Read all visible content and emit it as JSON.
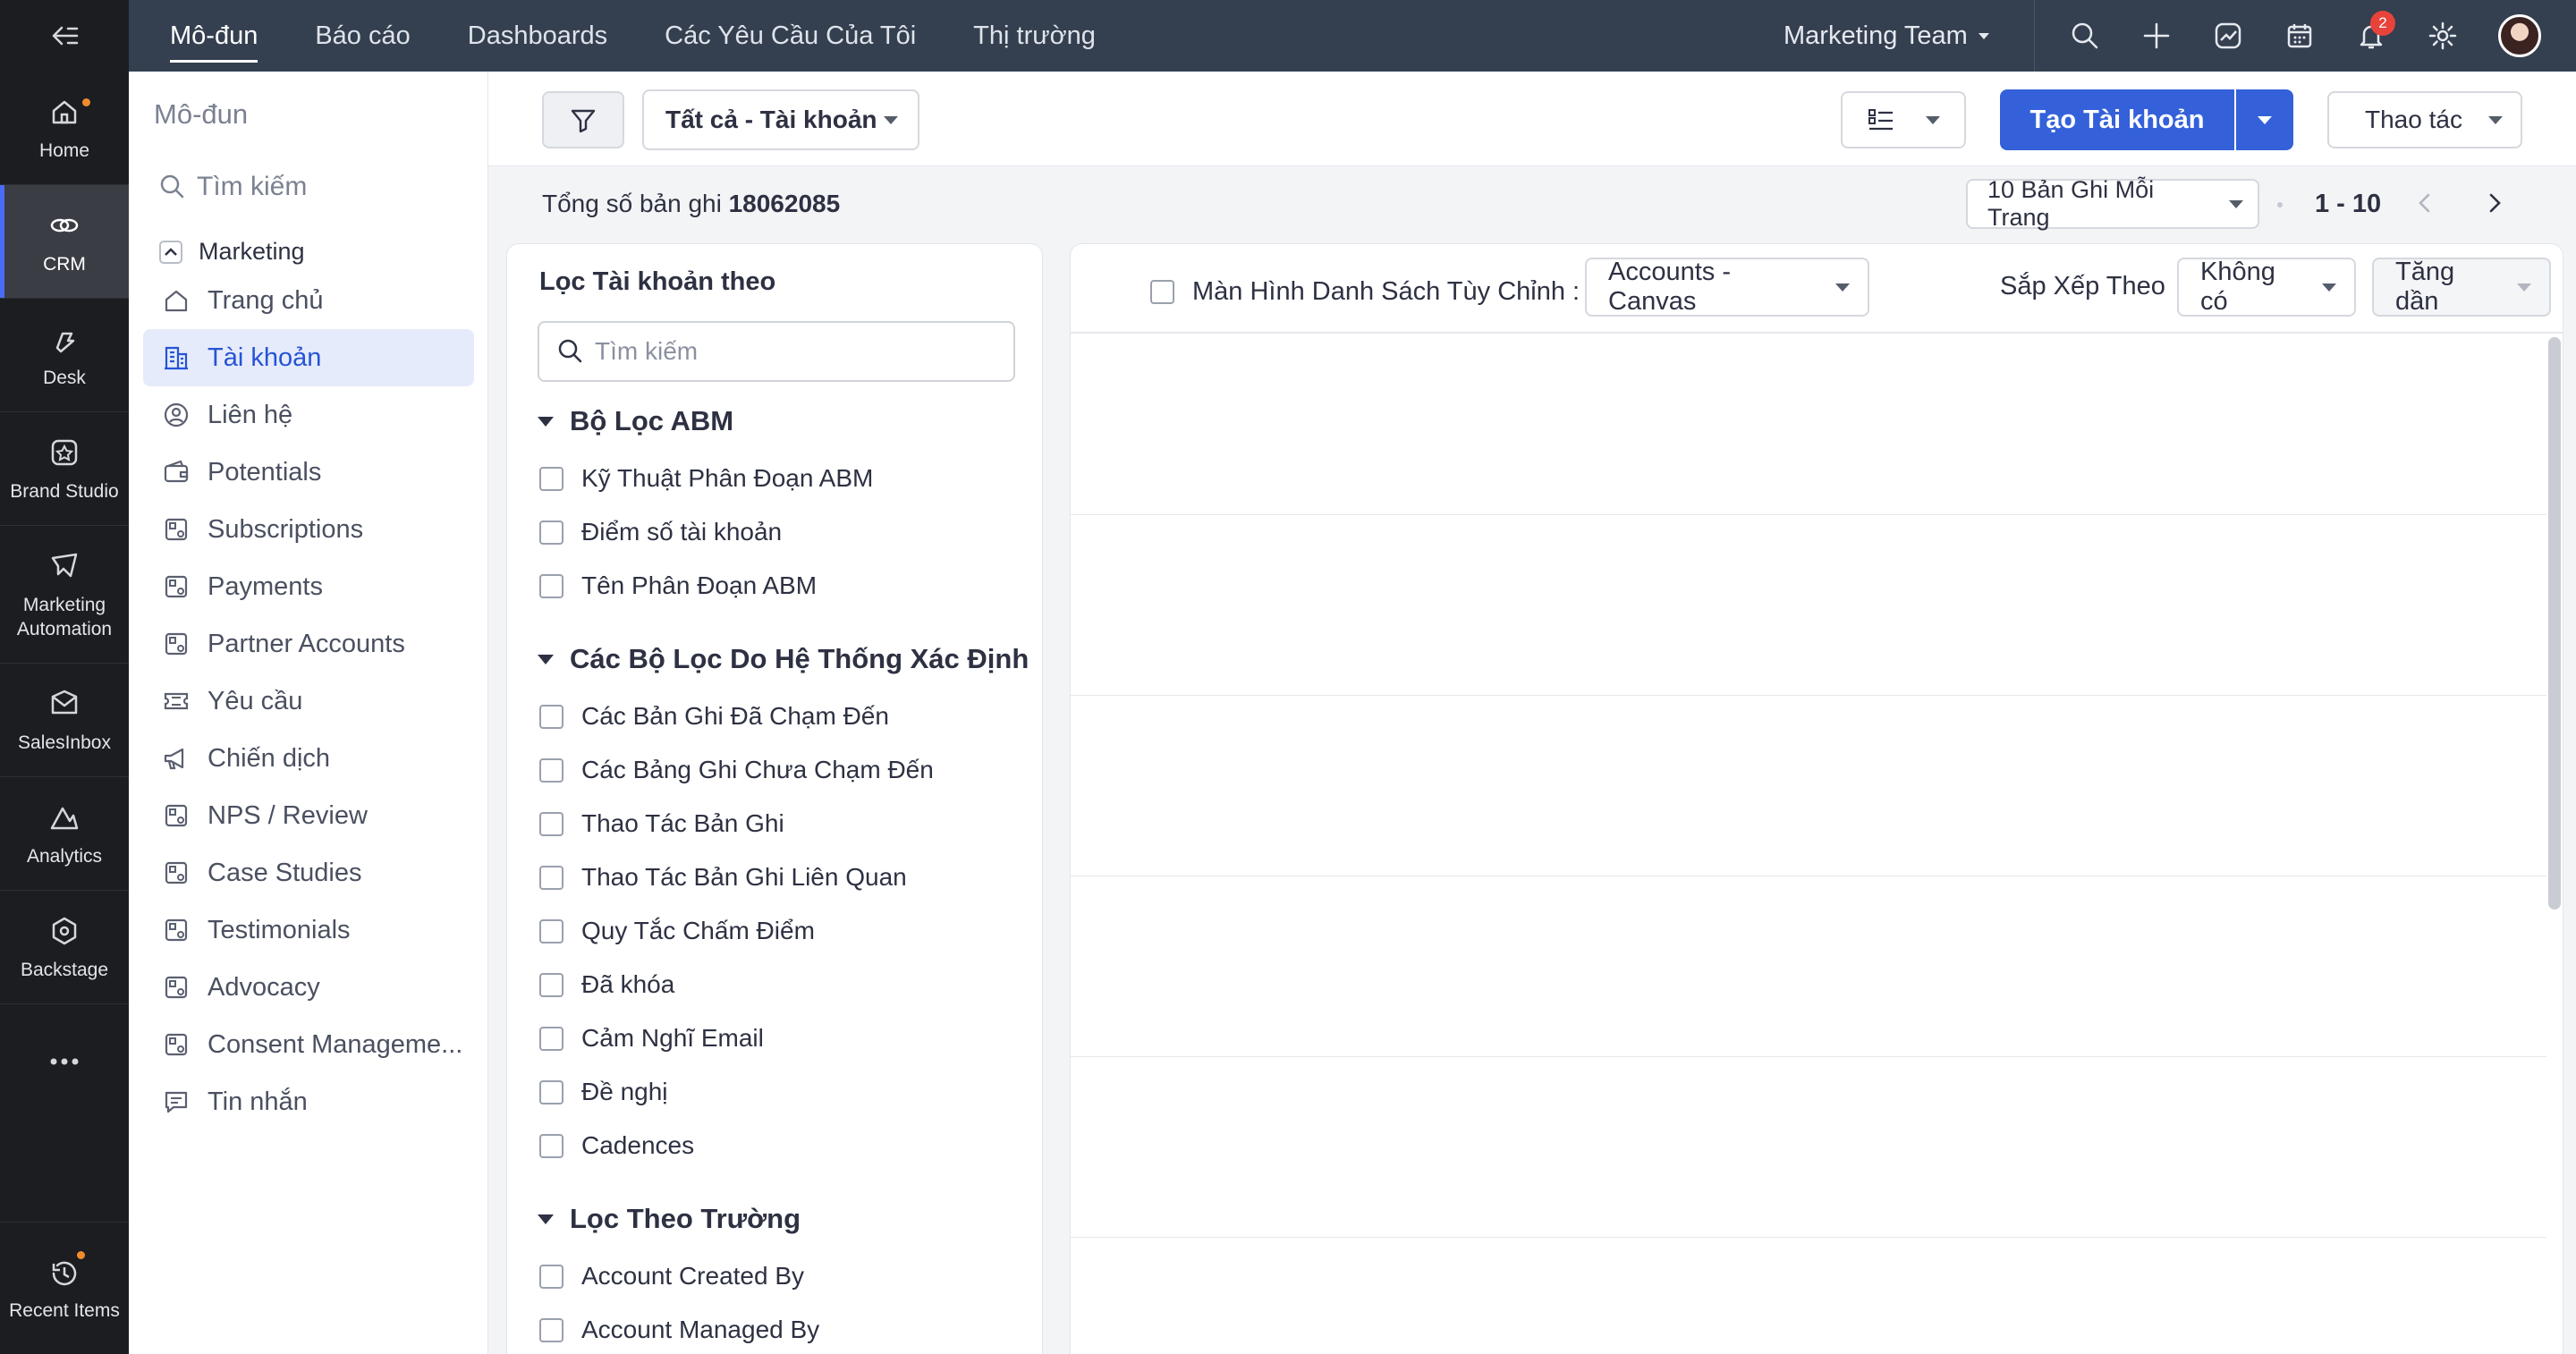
{
  "rail": {
    "items": [
      {
        "label": "Home",
        "icon": "home-icon"
      },
      {
        "label": "CRM",
        "icon": "crm-icon"
      },
      {
        "label": "Desk",
        "icon": "desk-icon"
      },
      {
        "label": "Brand Studio",
        "icon": "brand-studio-icon"
      },
      {
        "label": "Marketing Automation",
        "icon": "marketing-automation-icon"
      },
      {
        "label": "SalesInbox",
        "icon": "salesinbox-icon"
      },
      {
        "label": "Analytics",
        "icon": "analytics-icon"
      },
      {
        "label": "Backstage",
        "icon": "backstage-icon"
      }
    ],
    "recent": "Recent Items"
  },
  "topnav": {
    "tabs": [
      "Mô-đun",
      "Báo cáo",
      "Dashboards",
      "Các Yêu Cầu Của Tôi",
      "Thị trường"
    ],
    "team": "Marketing Team",
    "notif_count": "2"
  },
  "modules": {
    "title": "Mô-đun",
    "search": "Tìm kiếm",
    "group": "Marketing",
    "items": [
      {
        "label": "Trang chủ"
      },
      {
        "label": "Tài khoản"
      },
      {
        "label": "Liên hệ"
      },
      {
        "label": "Potentials"
      },
      {
        "label": "Subscriptions"
      },
      {
        "label": "Payments"
      },
      {
        "label": "Partner Accounts"
      },
      {
        "label": "Yêu cầu"
      },
      {
        "label": "Chiến dịch"
      },
      {
        "label": "NPS / Review"
      },
      {
        "label": "Case Studies"
      },
      {
        "label": "Testimonials"
      },
      {
        "label": "Advocacy"
      },
      {
        "label": "Consent Manageme..."
      },
      {
        "label": "Tin nhắn"
      }
    ]
  },
  "toolbar": {
    "view_select": "Tất cả - Tài khoản",
    "create": "Tạo Tài khoản",
    "actions": "Thao tác"
  },
  "records": {
    "total_label": "Tổng số bản ghi",
    "total_value": "18062085",
    "per_page": "10 Bản Ghi Mỗi Trang",
    "range": "1 - 10"
  },
  "filter": {
    "title": "Lọc Tài khoản theo",
    "search_placeholder": "Tìm kiếm",
    "sections": [
      {
        "title": "Bộ Lọc ABM",
        "items": [
          "Kỹ Thuật Phân Đoạn ABM",
          "Điểm số tài khoản",
          "Tên Phân Đoạn ABM"
        ]
      },
      {
        "title": "Các Bộ Lọc Do Hệ Thống Xác Định",
        "items": [
          "Các Bản Ghi Đã Chạm Đến",
          "Các Bảng Ghi Chưa Chạm Đến",
          "Thao Tác Bản Ghi",
          "Thao Tác Bản Ghi Liên Quan",
          "Quy Tắc Chấm Điểm",
          "Đã khóa",
          "Cảm Nghĩ Email",
          "Đề nghị",
          "Cadences"
        ]
      },
      {
        "title": "Lọc Theo Trường",
        "items": [
          "Account Created By",
          "Account Managed By"
        ]
      }
    ]
  },
  "list": {
    "custom_view_label": "Màn Hình Danh Sách Tùy Chỉnh :",
    "layout_select": "Accounts - Canvas",
    "sort_label": "Sắp Xếp Theo",
    "sort_field": "Không có",
    "sort_order": "Tăng dần"
  },
  "colors": {
    "primary": "#3461d9",
    "topbar": "#343f50",
    "rail": "#1b1d21",
    "active_module_bg": "#e5ebfb"
  }
}
